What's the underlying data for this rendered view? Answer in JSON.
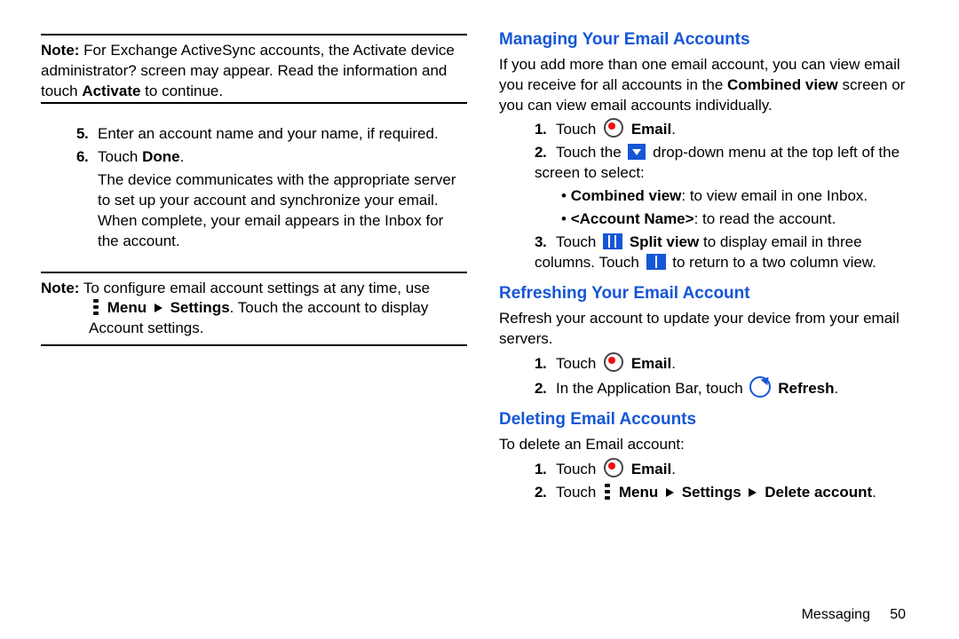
{
  "left": {
    "note1_label": "Note:",
    "note1_rest": " For Exchange ActiveSync accounts, the Activate device administrator? screen may appear. Read the information and touch ",
    "note1_bold": "Activate",
    "note1_tail": " to continue.",
    "s5_num": "5.",
    "s5_text": "Enter an account name and your name, if required.",
    "s6_num": "6.",
    "s6_a": "Touch ",
    "s6_bold": "Done",
    "s6_c": ".",
    "s6_body": "The device communicates with the appropriate server to set up your account and synchronize your email. When complete, your email appears in the Inbox for the account.",
    "note2_label": "Note:",
    "note2_a": " To configure email account settings at any time, use ",
    "note2_menu": "Menu",
    "note2_arrow": " ",
    "note2_settings": "Settings",
    "note2_c": ". Touch the account to display Account settings."
  },
  "right": {
    "h1": "Managing Your Email Accounts",
    "p1": "If you add more than one email account, you can view email you receive for all accounts in the ",
    "p1_bold": "Combined view",
    "p1_tail": " screen or you can view email accounts individually.",
    "s1n": "1.",
    "s1a": "Touch ",
    "s1b": "Email",
    "s1c": ".",
    "s2n": "2.",
    "s2a": "Touch the ",
    "s2b": " drop-down menu at the top left of the screen to select:",
    "b1a": "Combined view",
    "b1b": ": to view email in one Inbox.",
    "b2a": "<Account Name>",
    "b2b": ": to read the account.",
    "s3n": "3.",
    "s3a": "Touch ",
    "s3b": "Split view",
    "s3c": " to display email in three columns. Touch ",
    "s3d": " to return to a two column view.",
    "h2": "Refreshing Your Email Account",
    "p2": "Refresh your account to update your device from your email servers.",
    "r1n": "1.",
    "r1a": "Touch ",
    "r1b": "Email",
    "r1c": ".",
    "r2n": "2.",
    "r2a": "In the Application Bar, touch ",
    "r2b": "Refresh",
    "r2c": ".",
    "h3": "Deleting Email Accounts",
    "p3": "To delete an Email account:",
    "d1n": "1.",
    "d1a": "Touch ",
    "d1b": "Email",
    "d1c": ".",
    "d2n": "2.",
    "d2a": "Touch ",
    "d2m": "Menu",
    "d2s": "Settings",
    "d2d": "Delete account",
    "d2c": "."
  },
  "footer": {
    "section": "Messaging",
    "page": "50"
  }
}
